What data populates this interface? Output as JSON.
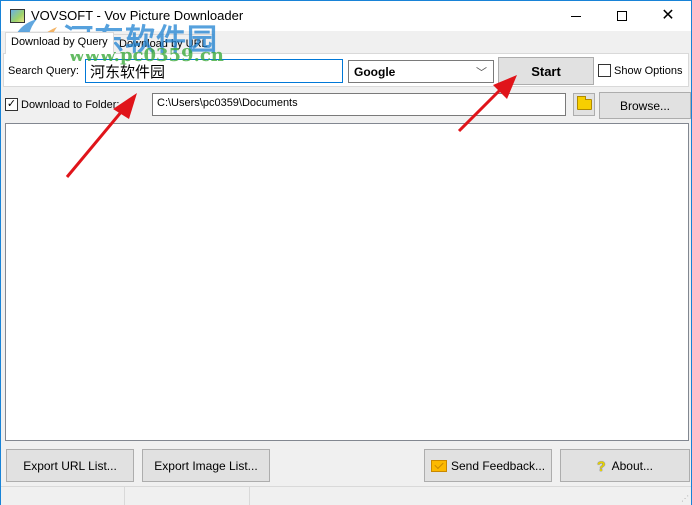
{
  "window": {
    "title": "VOVSOFT - Vov Picture Downloader",
    "controls": {
      "minimize": "minimize",
      "maximize": "maximize",
      "close": "✕"
    }
  },
  "tabs": [
    {
      "label": "Download by Query",
      "active": true
    },
    {
      "label": "Download by URL",
      "active": false
    }
  ],
  "query": {
    "label": "Search Query:",
    "value": "河东软件园",
    "engine": "Google",
    "engine_chevron": "﹀",
    "start_label": "Start",
    "show_options_label": "Show Options",
    "show_options_checked": false
  },
  "folder": {
    "checkbox_label": "Download to Folder:",
    "checked": true,
    "check_mark": "✓",
    "path": "C:\\Users\\pc0359\\Documents",
    "browse_label": "Browse..."
  },
  "footer": {
    "export_url_label": "Export URL List...",
    "export_image_label": "Export Image List...",
    "feedback_label": "Send Feedback...",
    "about_label": "About...",
    "about_glyph": "?"
  },
  "watermark": {
    "site_name": "河东软件园",
    "site_url": "www.pc0359.cn"
  },
  "colors": {
    "accent": "#0078d7",
    "window_border": "#1883d7",
    "arrow": "#e0141a"
  }
}
